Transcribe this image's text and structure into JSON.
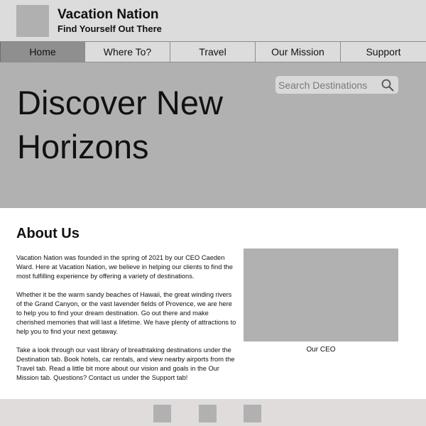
{
  "header": {
    "title": "Vacation Nation",
    "tagline": "Find Yourself Out There"
  },
  "nav": {
    "items": [
      "Home",
      "Where To?",
      "Travel",
      "Our Mission",
      "Support"
    ],
    "active": "Home"
  },
  "hero": {
    "title": "Discover New Horizons",
    "search_placeholder": "Search Destinations",
    "search_icon": "search-icon"
  },
  "about": {
    "heading": "About Us",
    "paragraphs": [
      "Vacation Nation was founded in the spring of 2021 by our CEO Caeden Ward. Here at Vacation Nation, we believe in helping our clients to find the most fulfilling experience by offering a variety of destinations.",
      "Whether it be the warm sandy beaches of Hawaii, the great winding rivers of the Grand Canyon, or the vast lavender fields of Provence, we are here to help you to find your dream destination. Go out there and make cherished memories that will last a lifetime. We have plenty of attractions to help you to find your next getaway.",
      "Take a look through our vast library of breathtaking destinations under the Destination tab. Book hotels, car rentals, and view nearby airports from the Travel tab. Read a little bit more about our vision and goals in the Our Mission tab. Questions? Contact us under the Support tab!"
    ],
    "image_caption": "Our CEO"
  },
  "colors": {
    "header_bg": "#dcdcdc",
    "hero_bg": "#b1b1b1",
    "active_tab_bg": "#8f8f8f",
    "footer_bg": "#e0dcdc",
    "placeholder_gray": "#b1b1b1"
  }
}
